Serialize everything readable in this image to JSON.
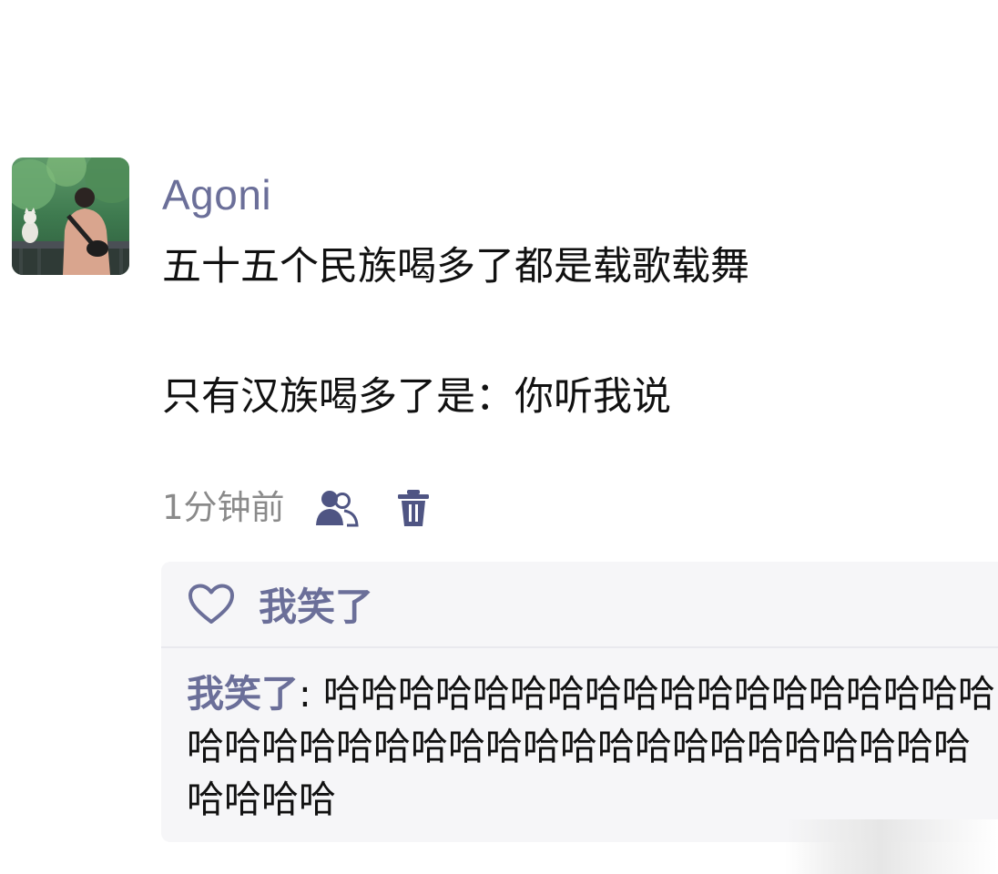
{
  "post": {
    "username": "Agoni",
    "content_line1": "五十五个民族喝多了都是载歌载舞",
    "content_line2": "只有汉族喝多了是：你听我说",
    "timestamp": "1分钟前",
    "icons": {
      "visibility": "users-icon",
      "delete": "trash-icon"
    }
  },
  "reactions": {
    "like_icon": "heart-outline-icon",
    "likers": "我笑了"
  },
  "reply": {
    "author": "我笑了",
    "separator": ": ",
    "text": "哈哈哈哈哈哈哈哈哈哈哈哈哈哈哈哈哈哈哈哈哈哈哈哈哈哈哈哈哈哈哈哈哈哈哈哈哈哈哈哈哈哈哈"
  },
  "colors": {
    "accent": "#6b6f99",
    "text": "#111111",
    "muted": "#8a8a8a",
    "reply_bg": "#f6f6f8"
  }
}
